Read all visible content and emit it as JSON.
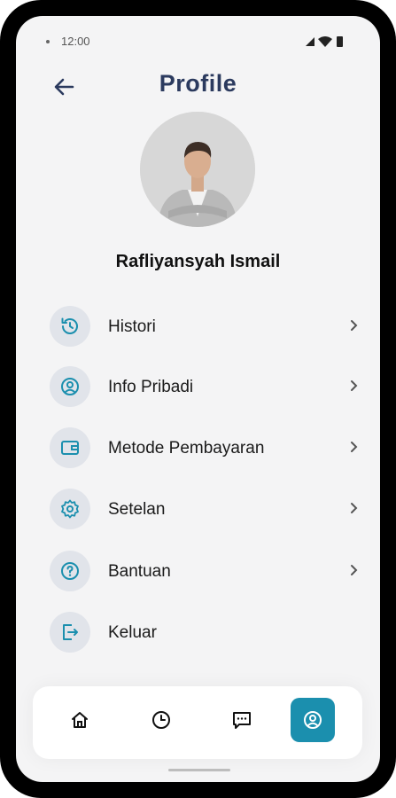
{
  "status_bar": {
    "time": "12:00"
  },
  "header": {
    "title": "Profile"
  },
  "profile": {
    "name": "Rafliyansyah Ismail"
  },
  "menu": [
    {
      "label": "Histori",
      "icon": "history-icon"
    },
    {
      "label": "Info Pribadi",
      "icon": "user-circle-icon"
    },
    {
      "label": "Metode Pembayaran",
      "icon": "wallet-icon"
    },
    {
      "label": "Setelan",
      "icon": "settings-icon"
    },
    {
      "label": "Bantuan",
      "icon": "help-icon"
    },
    {
      "label": "Keluar",
      "icon": "logout-icon"
    }
  ],
  "bottom_nav": [
    {
      "icon": "home-icon",
      "active": false
    },
    {
      "icon": "clock-icon",
      "active": false
    },
    {
      "icon": "chat-icon",
      "active": false
    },
    {
      "icon": "profile-icon",
      "active": true
    }
  ],
  "colors": {
    "accent": "#1b8fae",
    "title": "#2b3a5e",
    "icon_bg": "#e1e4ea"
  }
}
